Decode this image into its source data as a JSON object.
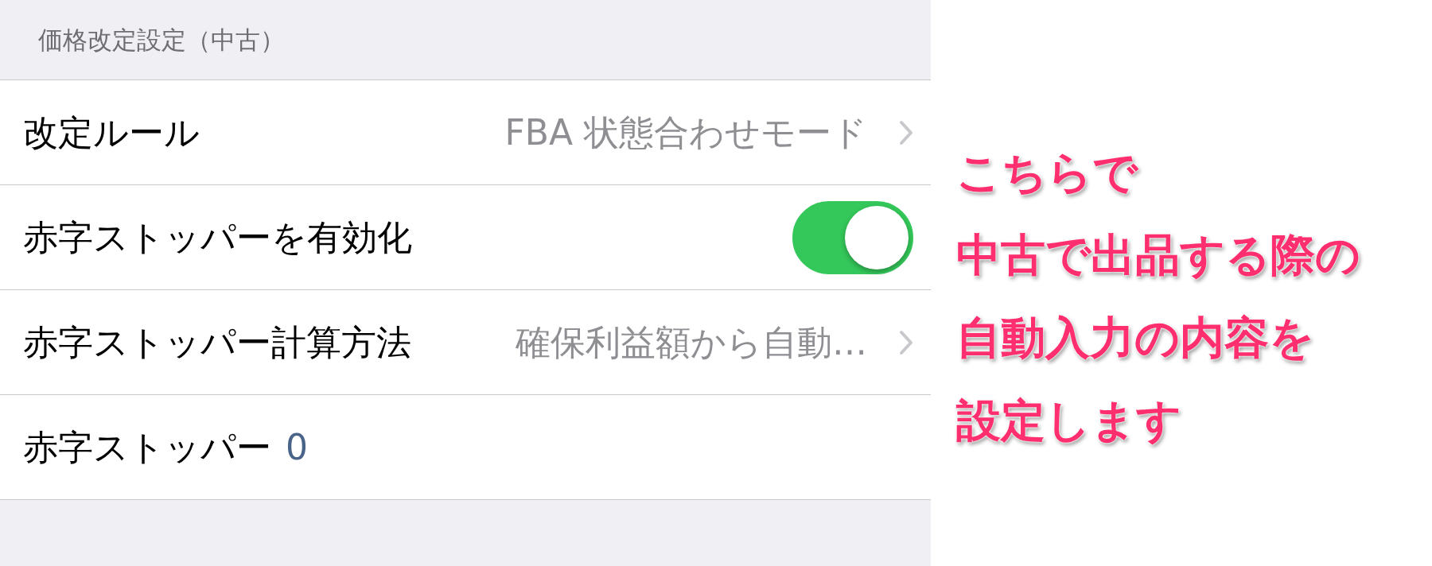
{
  "section_header": "価格改定設定（中古）",
  "rows": [
    {
      "kind": "link",
      "label": "改定ルール",
      "value": "FBA 状態合わせモード"
    },
    {
      "kind": "toggle",
      "label": "赤字ストッパーを有効化",
      "on": true
    },
    {
      "kind": "link",
      "label": "赤字ストッパー計算方法",
      "value": "確保利益額から自動…"
    },
    {
      "kind": "number",
      "label": "赤字ストッパー",
      "value": "0"
    }
  ],
  "annotation": [
    "こちらで",
    "中古で出品する際の",
    "自動入力の内容を",
    "設定します"
  ]
}
